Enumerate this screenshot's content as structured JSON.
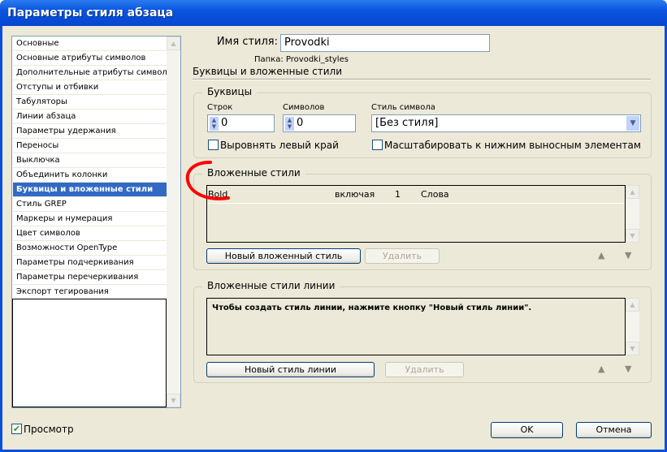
{
  "window": {
    "title": "Параметры стиля абзаца"
  },
  "sidebar": {
    "items": [
      {
        "label": "Основные"
      },
      {
        "label": "Основные атрибуты символов"
      },
      {
        "label": "Дополнительные атрибуты символов"
      },
      {
        "label": "Отступы и отбивки"
      },
      {
        "label": "Табуляторы"
      },
      {
        "label": "Линии абзаца"
      },
      {
        "label": "Параметры удержания"
      },
      {
        "label": "Переносы"
      },
      {
        "label": "Выключка"
      },
      {
        "label": "Объединить колонки"
      },
      {
        "label": "Буквицы и вложенные стили",
        "selected": true
      },
      {
        "label": "Стиль GREP"
      },
      {
        "label": "Маркеры и нумерация"
      },
      {
        "label": "Цвет символов"
      },
      {
        "label": "Возможности OpenType"
      },
      {
        "label": "Параметры подчеркивания"
      },
      {
        "label": "Параметры перечеркивания"
      },
      {
        "label": "Экспорт тегирования"
      }
    ]
  },
  "main": {
    "style_name_label": "Имя стиля:",
    "style_name_value": "Provodki",
    "folder_label": "Папка:",
    "folder_value": "Provodki_styles",
    "section_title": "Буквицы и вложенные стили",
    "drop_caps": {
      "title": "Буквицы",
      "lines_label": "Строк",
      "lines_value": "0",
      "chars_label": "Символов",
      "chars_value": "0",
      "char_style_label": "Стиль символа",
      "char_style_value": "[Без стиля]",
      "align_left_label": "Выровнять левый край",
      "align_left_checked": false,
      "scale_label": "Масштабировать к нижним выносным элементам",
      "scale_checked": false
    },
    "nested": {
      "title": "Вложенные стили",
      "rows": [
        {
          "style": "Bold",
          "mode": "включая",
          "count": "1",
          "unit": "Слова"
        }
      ],
      "new_button": "Новый вложенный стиль",
      "delete_button": "Удалить"
    },
    "nested_line": {
      "title": "Вложенные стили линии",
      "hint": "Чтобы создать стиль линии, нажмите кнопку \"Новый стиль линии\".",
      "new_button": "Новый стиль линии",
      "delete_button": "Удалить"
    }
  },
  "footer": {
    "preview_label": "Просмотр",
    "preview_checked": true,
    "ok": "OK",
    "cancel": "Отмена"
  },
  "colors": {
    "selection": "#316ac5",
    "annotation": "#ff0000",
    "titlebar": "#0a55e0"
  }
}
